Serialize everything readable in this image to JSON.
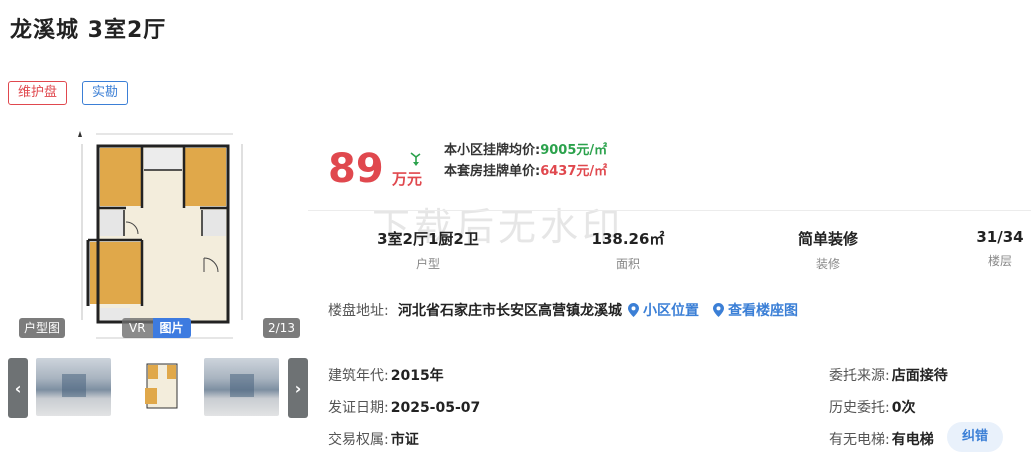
{
  "listing": {
    "title": "龙溪城 3室2厅",
    "tags": [
      "维护盘",
      "实勘"
    ]
  },
  "gallery": {
    "type_badge": "户型图",
    "mode_vr": "VR",
    "mode_pic": "图片",
    "counter": "2/13",
    "prev_glyph": "‹",
    "next_glyph": "›"
  },
  "price": {
    "total": "89",
    "unit": "万元",
    "trend_icon": "arrow-down-trend-icon",
    "community_avg_label": "本小区挂牌均价:",
    "community_avg_value": "9005元/㎡",
    "unit_price_label": "本套房挂牌单价:",
    "unit_price_value": "6437元/㎡"
  },
  "watermark": "下载后无水印",
  "stats": [
    {
      "value": "3室2厅1厨2卫",
      "label": "户型"
    },
    {
      "value": "138.26㎡",
      "label": "面积"
    },
    {
      "value": "简单装修",
      "label": "装修"
    },
    {
      "value": "31/34",
      "label": "楼层"
    }
  ],
  "address": {
    "label": "楼盘地址:",
    "value": "河北省石家庄市长安区高营镇龙溪城",
    "link_location": "小区位置",
    "link_building": "查看楼座图"
  },
  "details": {
    "built_year": {
      "label": "建筑年代:",
      "value": "2015年"
    },
    "cert_date": {
      "label": "发证日期:",
      "value": "2025-05-07"
    },
    "ownership": {
      "label": "交易权属:",
      "value": "市证"
    },
    "source": {
      "label": "委托来源:",
      "value": "店面接待"
    },
    "history": {
      "label": "历史委托:",
      "value": "0次"
    },
    "elevator": {
      "label": "有无电梯:",
      "value": "有电梯"
    }
  },
  "fix_button": "纠错",
  "colors": {
    "price_red": "#e0484e",
    "avg_green": "#2ba24c",
    "link_blue": "#3b7fd6"
  }
}
